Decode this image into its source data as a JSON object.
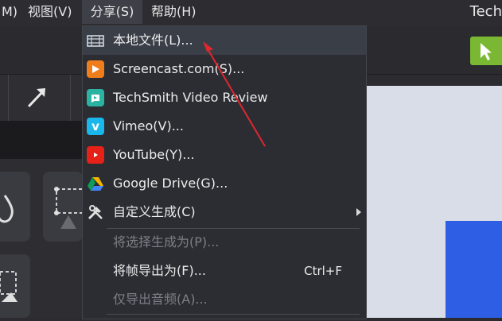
{
  "menubar": {
    "items": [
      {
        "label": "M)"
      },
      {
        "label": "视图(V)"
      },
      {
        "label": "分享(S)"
      },
      {
        "label": "帮助(H)"
      }
    ],
    "brand": "Tech"
  },
  "share_menu": {
    "items": [
      {
        "label": "本地文件(L)...",
        "icon": "film-icon",
        "state": "highlighted"
      },
      {
        "label": "Screencast.com(S)...",
        "icon": "screencast-icon"
      },
      {
        "label": "TechSmith Video Review",
        "icon": "video-review-icon"
      },
      {
        "label": "Vimeo(V)...",
        "icon": "vimeo-icon"
      },
      {
        "label": "YouTube(Y)...",
        "icon": "youtube-icon"
      },
      {
        "label": "Google Drive(G)...",
        "icon": "google-drive-icon"
      },
      {
        "label": "自定义生成(C)",
        "icon": "tools-icon",
        "has_submenu": true
      },
      {
        "label": "将选择生成为(P)...",
        "state": "disabled"
      },
      {
        "label": "将帧导出为(F)...",
        "shortcut": "Ctrl+F"
      },
      {
        "label": "仅导出音频(A)...",
        "state": "disabled"
      }
    ]
  },
  "colors": {
    "accent_green": "#7ab833",
    "annotation_arrow": "#e0272f",
    "screencast_orange": "#f07d1b",
    "review_teal": "#2bb3a2",
    "vimeo_blue": "#1ab7ea",
    "youtube_red": "#e62117"
  }
}
